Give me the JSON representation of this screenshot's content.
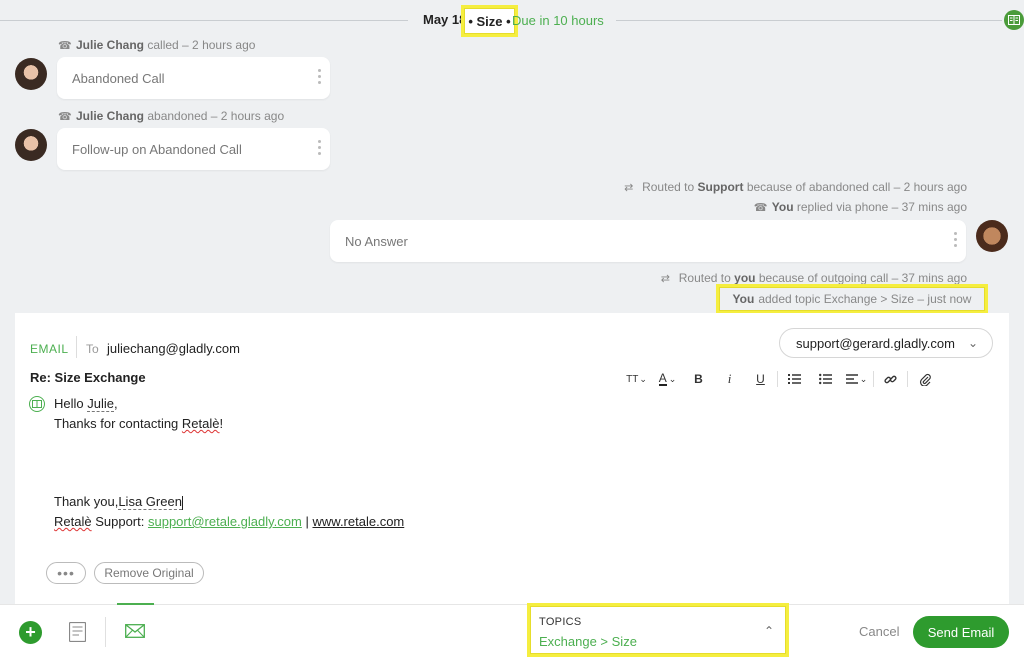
{
  "header": {
    "date": "May 18",
    "size_badge": "• Size •",
    "due": "Due in 10 hours"
  },
  "timeline": {
    "event1": {
      "actor": "Julie Chang",
      "action": "called – 2 hours ago",
      "bubble": "Abandoned Call"
    },
    "event2": {
      "actor": "Julie Chang",
      "action": "abandoned – 2 hours ago",
      "bubble": "Follow-up on Abandoned Call"
    },
    "routed1": {
      "prefix": "Routed to",
      "target": "Support",
      "suffix": "because of abandoned call – 2 hours ago"
    },
    "replied": {
      "actor": "You",
      "action": "replied via phone – 37 mins ago"
    },
    "outgoing_bubble": "No Answer",
    "routed2": {
      "prefix": "Routed to",
      "target": "you",
      "suffix": "because of outgoing call – 37 mins ago"
    },
    "topic_note": {
      "actor": "You",
      "text": "added topic Exchange > Size – just now"
    }
  },
  "composer": {
    "channel": "EMAIL",
    "to_label": "To",
    "to_email": "juliechang@gladly.com",
    "from_email": "support@gerard.gladly.com",
    "subject": "Re: Size Exchange",
    "toolbar": {
      "text_size": "TT",
      "font_color": "A",
      "bold": "B",
      "italic": "i",
      "underline": "U"
    },
    "body": {
      "greeting_prefix": "Hello",
      "greeting_name": "Julie",
      "greeting_suffix": ",",
      "thanks_prefix": "Thanks for contacting",
      "thanks_brand": "Retalè",
      "thanks_suffix": "!",
      "signoff_prefix": "Thank you,",
      "signoff_name": "Lisa Green",
      "sig_brand": "Retalè",
      "sig_label": "Support:",
      "sig_email": "support@retale.gladly.com",
      "sig_sep": "|",
      "sig_site": "www.retale.com"
    },
    "ellipsis": "•••",
    "remove_original": "Remove Original"
  },
  "bottom_bar": {
    "topics_label": "TOPICS",
    "topics_value": "Exchange > Size",
    "cancel": "Cancel",
    "send": "Send Email"
  },
  "colors": {
    "accent": "#4caf50",
    "primary_button": "#2e9b2e",
    "highlight": "#f5ee3f"
  }
}
